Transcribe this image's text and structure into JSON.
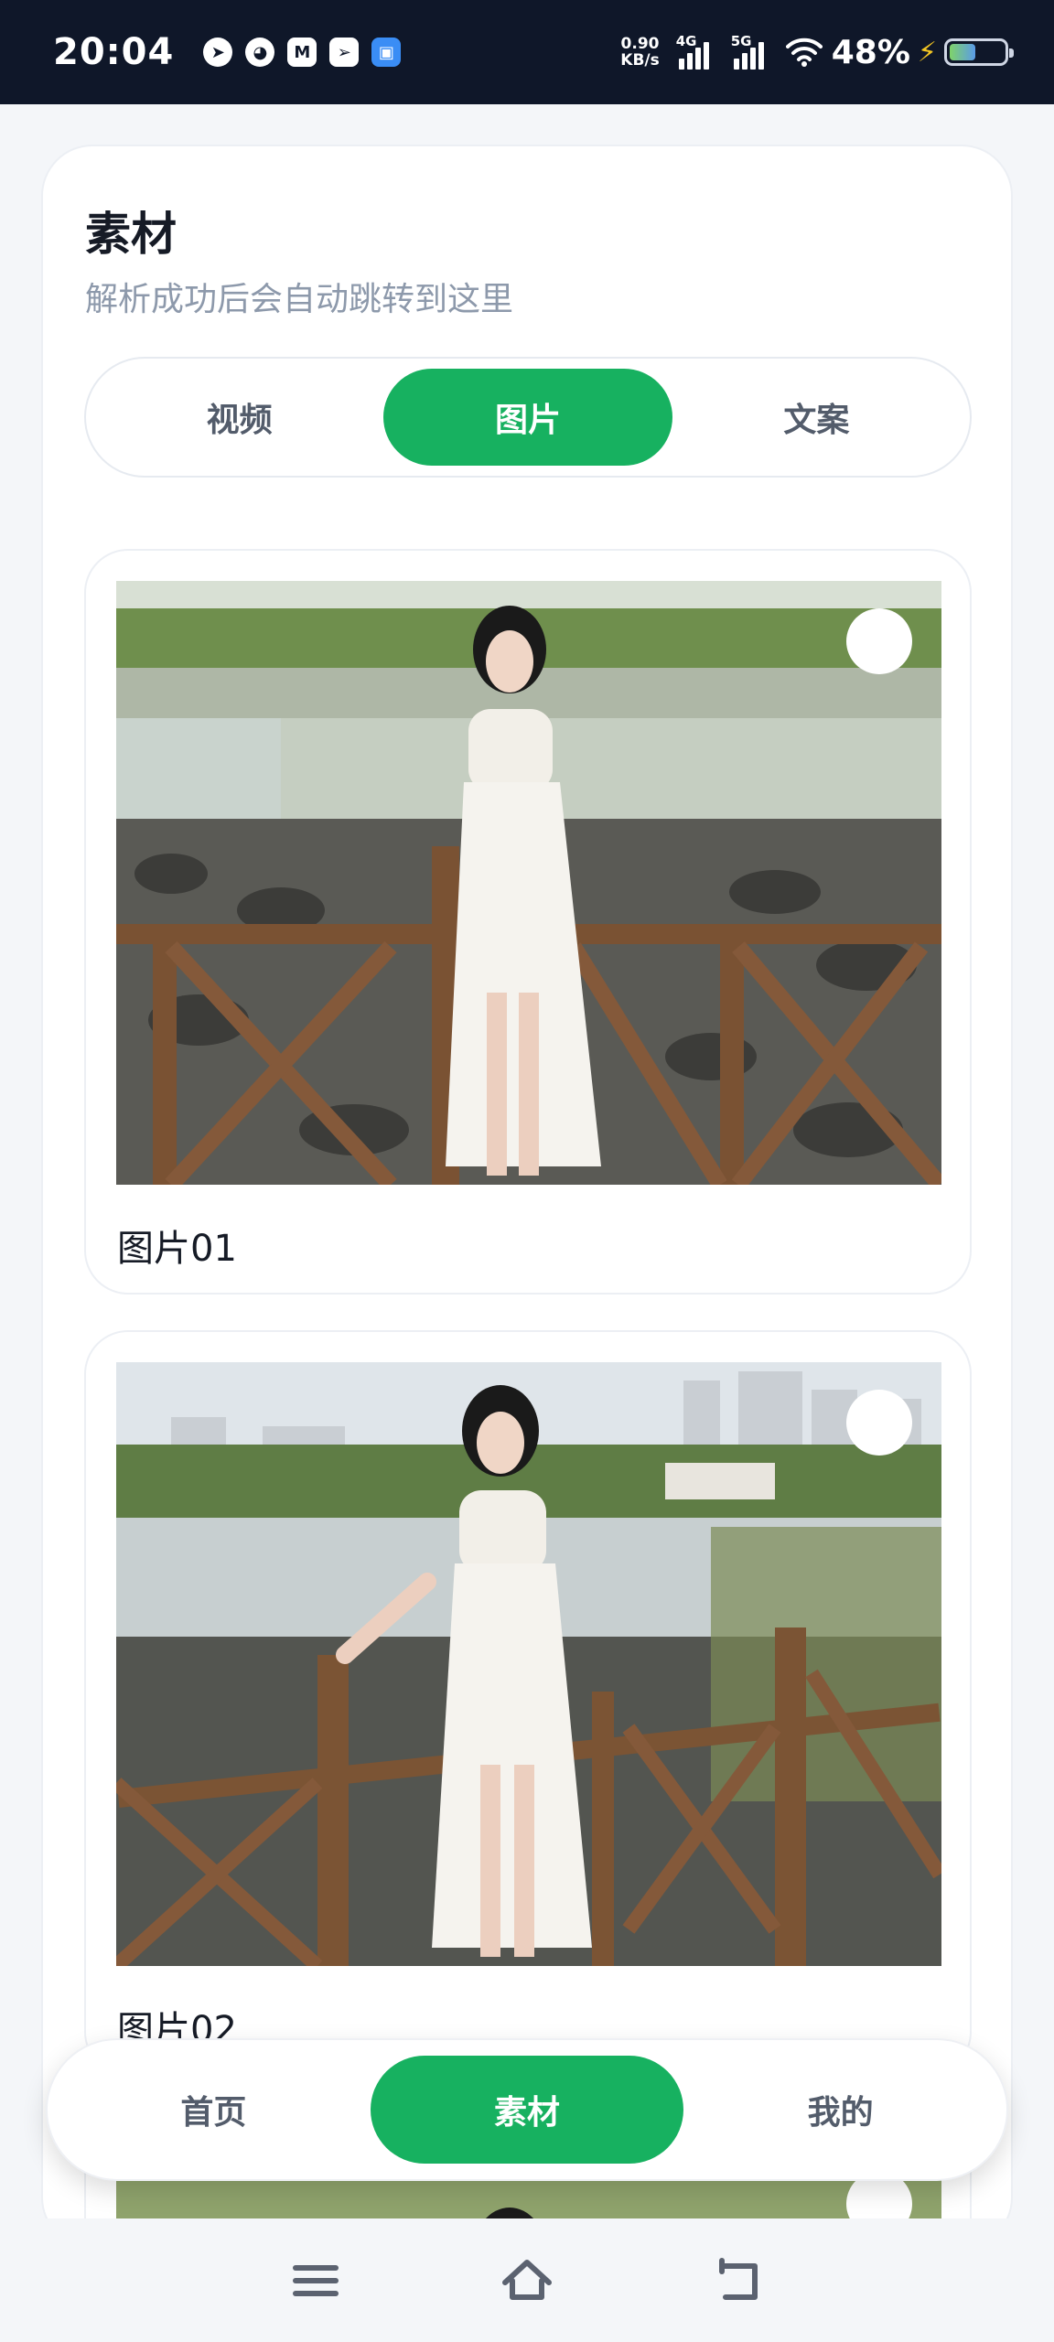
{
  "status_bar": {
    "time": "20:04",
    "net_speed_value": "0.90",
    "net_speed_unit": "KB/s",
    "sim1": "4G",
    "sim2": "5G",
    "battery_percent": "48%",
    "battery_level": 0.48,
    "app_icons": [
      "telegram-icon",
      "wechat-icon",
      "gmail-icon",
      "send-icon",
      "app-icon"
    ]
  },
  "page": {
    "title": "素材",
    "subtitle": "解析成功后会自动跳转到这里"
  },
  "tabs": [
    {
      "label": "视频",
      "active": false
    },
    {
      "label": "图片",
      "active": true
    },
    {
      "label": "文案",
      "active": false
    }
  ],
  "items": [
    {
      "label": "图片01",
      "selected": false
    },
    {
      "label": "图片02",
      "selected": false
    },
    {
      "label": "",
      "selected": false
    }
  ],
  "bottom_nav": [
    {
      "label": "首页",
      "active": false
    },
    {
      "label": "素材",
      "active": true
    },
    {
      "label": "我的",
      "active": false
    }
  ],
  "colors": {
    "accent": "#17b160",
    "status_bar_bg": "#0f1729",
    "page_bg": "#f4f6f9"
  }
}
